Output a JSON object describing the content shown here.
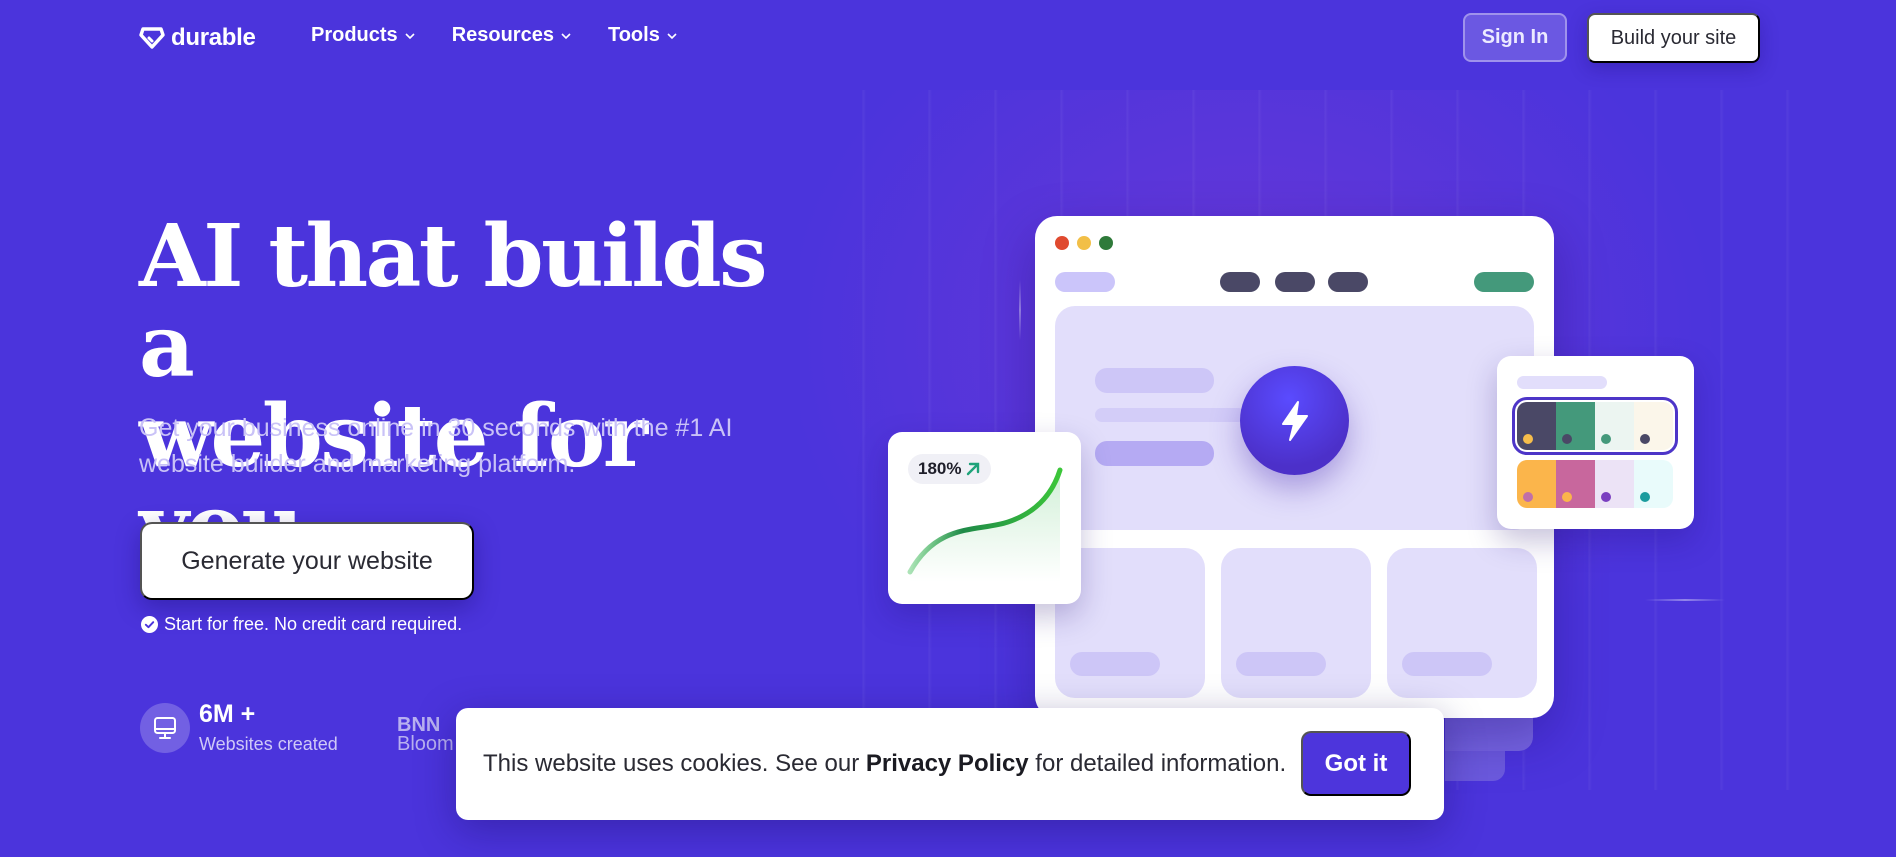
{
  "nav": {
    "logo_text": "durable",
    "menu": [
      {
        "label": "Products"
      },
      {
        "label": "Resources"
      },
      {
        "label": "Tools"
      }
    ],
    "sign_in_label": "Sign In",
    "build_site_label": "Build your site"
  },
  "hero": {
    "headline_line1": "AI that builds a",
    "headline_line2": "website for you.",
    "subtitle": "Get your business online in 30 seconds with the #1 AI website builder and marketing platform.",
    "cta_label": "Generate your website",
    "free_note": "Start for free. No credit card required."
  },
  "stats": {
    "value": "6M +",
    "label": "Websites created",
    "icon": "monitor-icon"
  },
  "press": {
    "line1": "BNN",
    "line2": "Bloom"
  },
  "mockup": {
    "growth_badge": "180%",
    "window_dots": [
      "#e04a2f",
      "#f2bf47",
      "#2f7a3a"
    ],
    "nav_pill_colors": {
      "logo": "#cbc5fa",
      "links": "#4a4866",
      "button": "#44997b"
    },
    "palettes": [
      {
        "selected": true,
        "swatches": [
          {
            "color": "#4a4866",
            "dot": "#f6bd4b"
          },
          {
            "color": "#44997b",
            "dot": "#4a4866"
          },
          {
            "color": "#ecf5f1",
            "dot": "#44997b"
          },
          {
            "color": "#fbf6ea",
            "dot": "#4a4866"
          }
        ]
      },
      {
        "selected": false,
        "swatches": [
          {
            "color": "#fbb54b",
            "dot": "#c16fa8"
          },
          {
            "color": "#c8679d",
            "dot": "#fbb54b"
          },
          {
            "color": "#ece3f6",
            "dot": "#7a3fc0"
          },
          {
            "color": "#e9fbfb",
            "dot": "#1c9c9e"
          }
        ]
      }
    ]
  },
  "cookie": {
    "text_before": "This website uses cookies. See our ",
    "link_label": "Privacy Policy",
    "text_after": " for detailed information.",
    "button_label": "Got it"
  },
  "colors": {
    "brand": "#4b34dc",
    "button_primary": "#4d35dc",
    "growth_green": "#2fb84a"
  }
}
